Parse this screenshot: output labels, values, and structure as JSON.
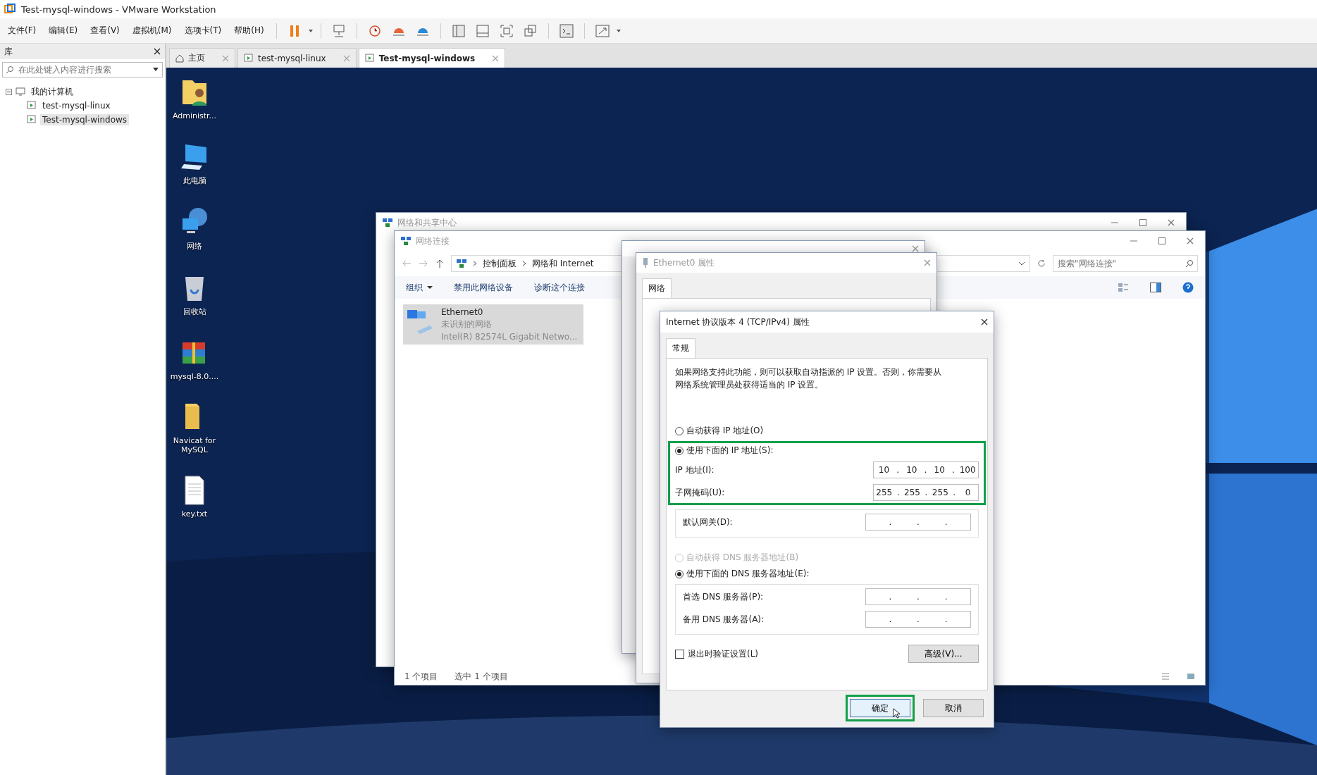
{
  "window": {
    "title": "Test-mysql-windows - VMware Workstation"
  },
  "menu": [
    {
      "label": "文件(F)"
    },
    {
      "label": "编辑(E)"
    },
    {
      "label": "查看(V)"
    },
    {
      "label": "虚拟机(M)"
    },
    {
      "label": "选项卡(T)"
    },
    {
      "label": "帮助(H)"
    }
  ],
  "library": {
    "title": "库",
    "search": {
      "placeholder": "在此处键入内容进行搜索"
    },
    "tree": [
      {
        "label": "我的计算机",
        "expanded": true,
        "children": [
          {
            "label": "test-mysql-linux",
            "selected": false
          },
          {
            "label": "Test-mysql-windows",
            "selected": true
          }
        ]
      }
    ]
  },
  "tabs": [
    {
      "label": "主页",
      "kind": "home",
      "selected": false
    },
    {
      "label": "test-mysql-linux",
      "kind": "vm",
      "selected": false
    },
    {
      "label": "Test-mysql-windows",
      "kind": "vm",
      "selected": true
    }
  ],
  "desktop_icons": [
    {
      "label": "Administr...",
      "kind": "user"
    },
    {
      "label": "此电脑",
      "kind": "computer"
    },
    {
      "label": "网络",
      "kind": "network"
    },
    {
      "label": "回收站",
      "kind": "bin"
    },
    {
      "label": "mysql-8.0....",
      "kind": "archive"
    },
    {
      "label": "Navicat for MySQL",
      "kind": "folder"
    },
    {
      "label": "key.txt",
      "kind": "text"
    }
  ],
  "network_center": {
    "title": "网络和共享中心"
  },
  "network_connections": {
    "title": "网络连接",
    "breadcrumb": [
      "控制面板",
      "网络和 Internet"
    ],
    "search": {
      "placeholder": "搜索\"网络连接\""
    },
    "commands": [
      {
        "label": "组织",
        "menu": true
      },
      {
        "label": "禁用此网络设备",
        "menu": false
      },
      {
        "label": "诊断这个连接",
        "menu": false
      }
    ],
    "items": [
      {
        "name": "Ethernet0",
        "status": "未识别的网络",
        "adapter": "Intel(R) 82574L Gigabit Netwo...",
        "selected": true
      }
    ],
    "status_bar": [
      "1 个项目",
      "选中 1 个项目"
    ]
  },
  "ethernet_properties": {
    "title": "Ethernet0 属性",
    "tabs": [
      {
        "label": "网络",
        "selected": true
      }
    ]
  },
  "ipv4_dialog": {
    "title": "Internet 协议版本 4 (TCP/IPv4) 属性",
    "tabs": [
      {
        "label": "常规",
        "selected": true
      }
    ],
    "description": "如果网络支持此功能，则可以获取自动指派的 IP 设置。否则，你需要从网络系统管理员处获得适当的 IP 设置。",
    "separator": ".",
    "ip_mode": [
      {
        "label": "自动获得 IP 地址(O)",
        "selected": false
      },
      {
        "label": "使用下面的 IP 地址(S):",
        "selected": true,
        "highlighted": true
      }
    ],
    "ip_fields": [
      {
        "label": "IP 地址(I):",
        "octets": [
          "10",
          "10",
          "10",
          "100"
        ],
        "highlighted": true
      },
      {
        "label": "子网掩码(U):",
        "octets": [
          "255",
          "255",
          "255",
          "0"
        ],
        "highlighted": true
      },
      {
        "label": "默认网关(D):",
        "highlighted": false
      }
    ],
    "dns_mode": [
      {
        "label": "自动获得 DNS 服务器地址(B)",
        "selected": false,
        "disabled": true
      },
      {
        "label": "使用下面的 DNS 服务器地址(E):",
        "selected": true,
        "disabled": false
      }
    ],
    "dns_fields": [
      {
        "label": "首选 DNS 服务器(P):"
      },
      {
        "label": "备用 DNS 服务器(A):"
      }
    ],
    "validate": {
      "label": "退出时验证设置(L)",
      "checked": false
    },
    "advanced": "高级(V)...",
    "buttons": [
      {
        "label": "确定",
        "kind": "primary",
        "highlighted": true
      },
      {
        "label": "取消",
        "kind": "default",
        "highlighted": false
      }
    ]
  }
}
